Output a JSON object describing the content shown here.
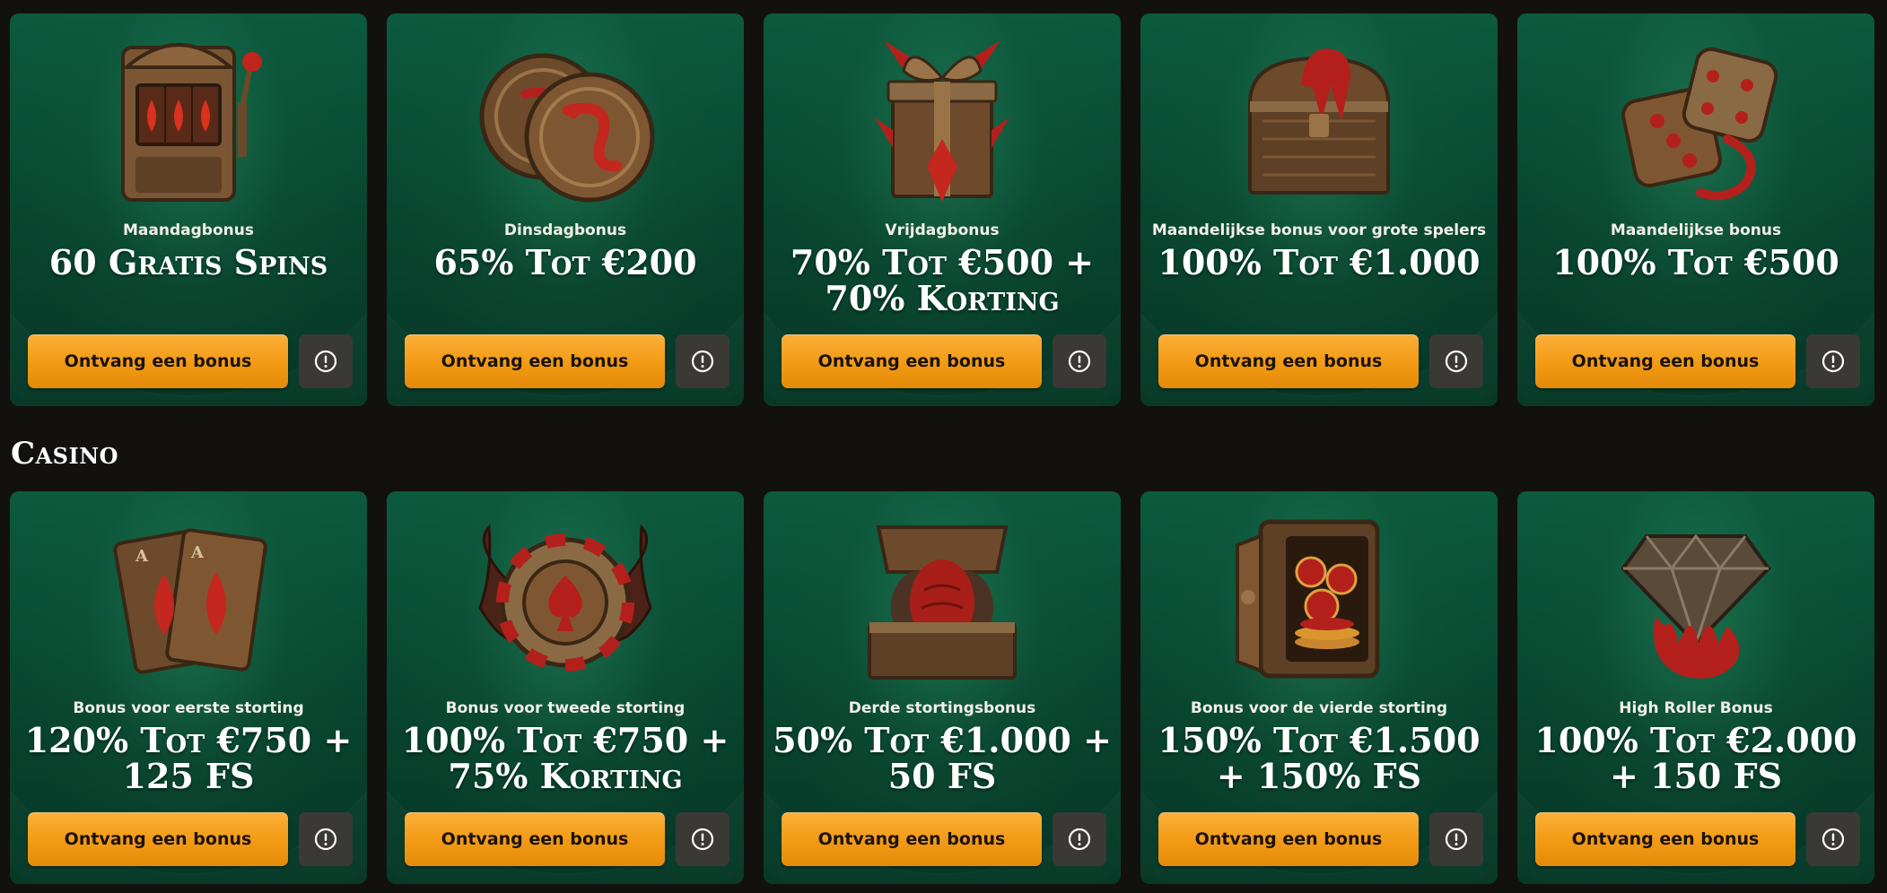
{
  "section_casino": "Casino",
  "button_label": "Ontvang een bonus",
  "row1": [
    {
      "subtitle": "Maandagbonus",
      "title": "60 Gratis Spins",
      "icon": "slot-machine-icon"
    },
    {
      "subtitle": "Dinsdagbonus",
      "title": "65% Tot €200",
      "icon": "dragon-coins-icon"
    },
    {
      "subtitle": "Vrijdagbonus",
      "title": "70% Tot €500 + 70% Korting",
      "icon": "gift-box-icon"
    },
    {
      "subtitle": "Maandelijkse bonus voor grote spelers",
      "title": "100% Tot €1.000",
      "icon": "treasure-chest-claw-icon"
    },
    {
      "subtitle": "Maandelijkse bonus",
      "title": "100% Tot €500",
      "icon": "dice-icon"
    }
  ],
  "row2": [
    {
      "subtitle": "Bonus voor eerste storting",
      "title": "120% Tot €750 + 125 FS",
      "icon": "playing-cards-icon"
    },
    {
      "subtitle": "Bonus voor tweede storting",
      "title": "100% Tot €750 + 75% Korting",
      "icon": "winged-poker-chip-icon"
    },
    {
      "subtitle": "Derde stortingsbonus",
      "title": "50% Tot €1.000 + 50 FS",
      "icon": "dragon-eggs-chest-icon"
    },
    {
      "subtitle": "Bonus voor de vierde storting",
      "title": "150% Tot €1.500 + 150% FS",
      "icon": "safe-coins-icon"
    },
    {
      "subtitle": "High Roller Bonus",
      "title": "100% Tot €2.000 + 150 FS",
      "icon": "diamond-claw-icon"
    }
  ],
  "colors": {
    "page_bg": "#131010",
    "card_bg": "#0a4e37",
    "button_orange": "#f29a14",
    "info_button_bg": "#3b3936",
    "accent_red": "#b3201b",
    "bronze": "#8a6a45"
  }
}
